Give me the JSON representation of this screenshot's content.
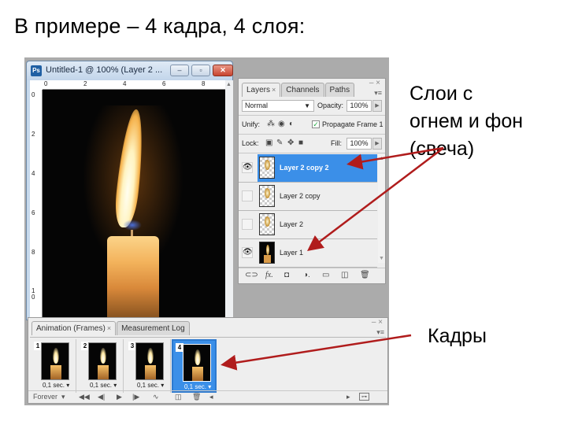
{
  "slide": {
    "title": "В примере – 4 кадра, 4 слоя:",
    "note_layers_lines": [
      "Слои с",
      "огнем и фон",
      "(свеча)"
    ],
    "note_frames": "Кадры",
    "arrow_color": "#b01c1c"
  },
  "document_window": {
    "title": "Untitled-1 @ 100% (Layer 2 ...",
    "app_icon": "Ps",
    "buttons": {
      "minimize": "–",
      "maximize": "▫",
      "close": "✕"
    },
    "ruler_h_labels": [
      "0",
      "2",
      "4",
      "6",
      "8"
    ],
    "ruler_v_labels": [
      "0",
      "2",
      "4",
      "6",
      "8",
      "1\n0"
    ]
  },
  "layers_panel": {
    "tabs": [
      {
        "label": "Layers",
        "close": "×",
        "active": true
      },
      {
        "label": "Channels",
        "active": false
      },
      {
        "label": "Paths",
        "active": false
      }
    ],
    "panel_controls": "– ×",
    "blend_mode": "Normal",
    "opacity_label": "Opacity:",
    "opacity_value": "100%",
    "unify_label": "Unify:",
    "propagate_label": "Propagate Frame 1",
    "propagate_checked": true,
    "lock_label": "Lock:",
    "fill_label": "Fill:",
    "fill_value": "100%",
    "layers": [
      {
        "name": "Layer 2 copy 2",
        "visible": true,
        "selected": true,
        "thumb": "flame"
      },
      {
        "name": "Layer 2 copy",
        "visible": false,
        "selected": false,
        "thumb": "flame"
      },
      {
        "name": "Layer 2",
        "visible": false,
        "selected": false,
        "thumb": "flame"
      },
      {
        "name": "Layer 1",
        "visible": true,
        "selected": false,
        "thumb": "candle"
      }
    ],
    "footer_icons": [
      "link-icon",
      "fx-icon",
      "mask-icon",
      "adjustment-icon",
      "group-icon",
      "new-layer-icon",
      "trash-icon"
    ]
  },
  "animation_panel": {
    "tabs": [
      {
        "label": "Animation (Frames)",
        "close": "×",
        "active": true
      },
      {
        "label": "Measurement Log",
        "active": false
      }
    ],
    "panel_controls": "– ×",
    "frames": [
      {
        "number": "1",
        "delay": "0,1 sec.",
        "selected": false
      },
      {
        "number": "2",
        "delay": "0,1 sec.",
        "selected": false
      },
      {
        "number": "3",
        "delay": "0,1 sec.",
        "selected": false
      },
      {
        "number": "4",
        "delay": "0,1 sec.",
        "selected": true
      }
    ],
    "loop_option": "Forever",
    "selection_color": "#3b8fe8"
  }
}
